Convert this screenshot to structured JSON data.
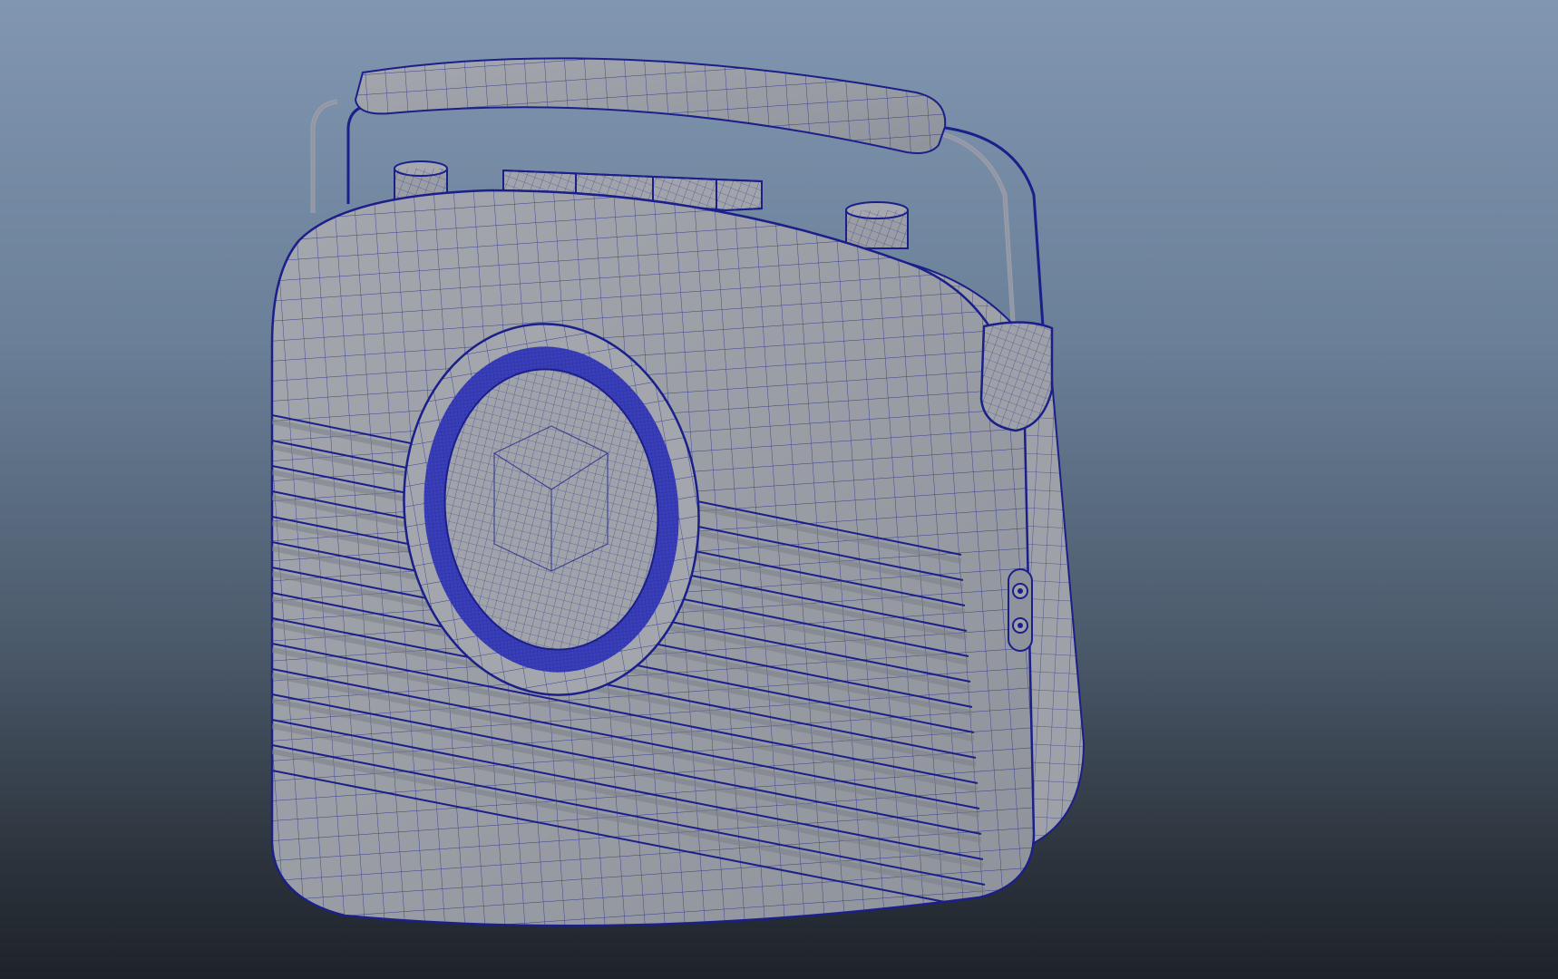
{
  "viewport": {
    "mode": "wireframe-on-shaded",
    "subject": "retro-portable-radio-model"
  },
  "colors": {
    "background_top": "#8196b0",
    "background_bottom": "#1e2329",
    "shaded_surface": "#9b9ea5",
    "wire": "#1a1f8a"
  }
}
